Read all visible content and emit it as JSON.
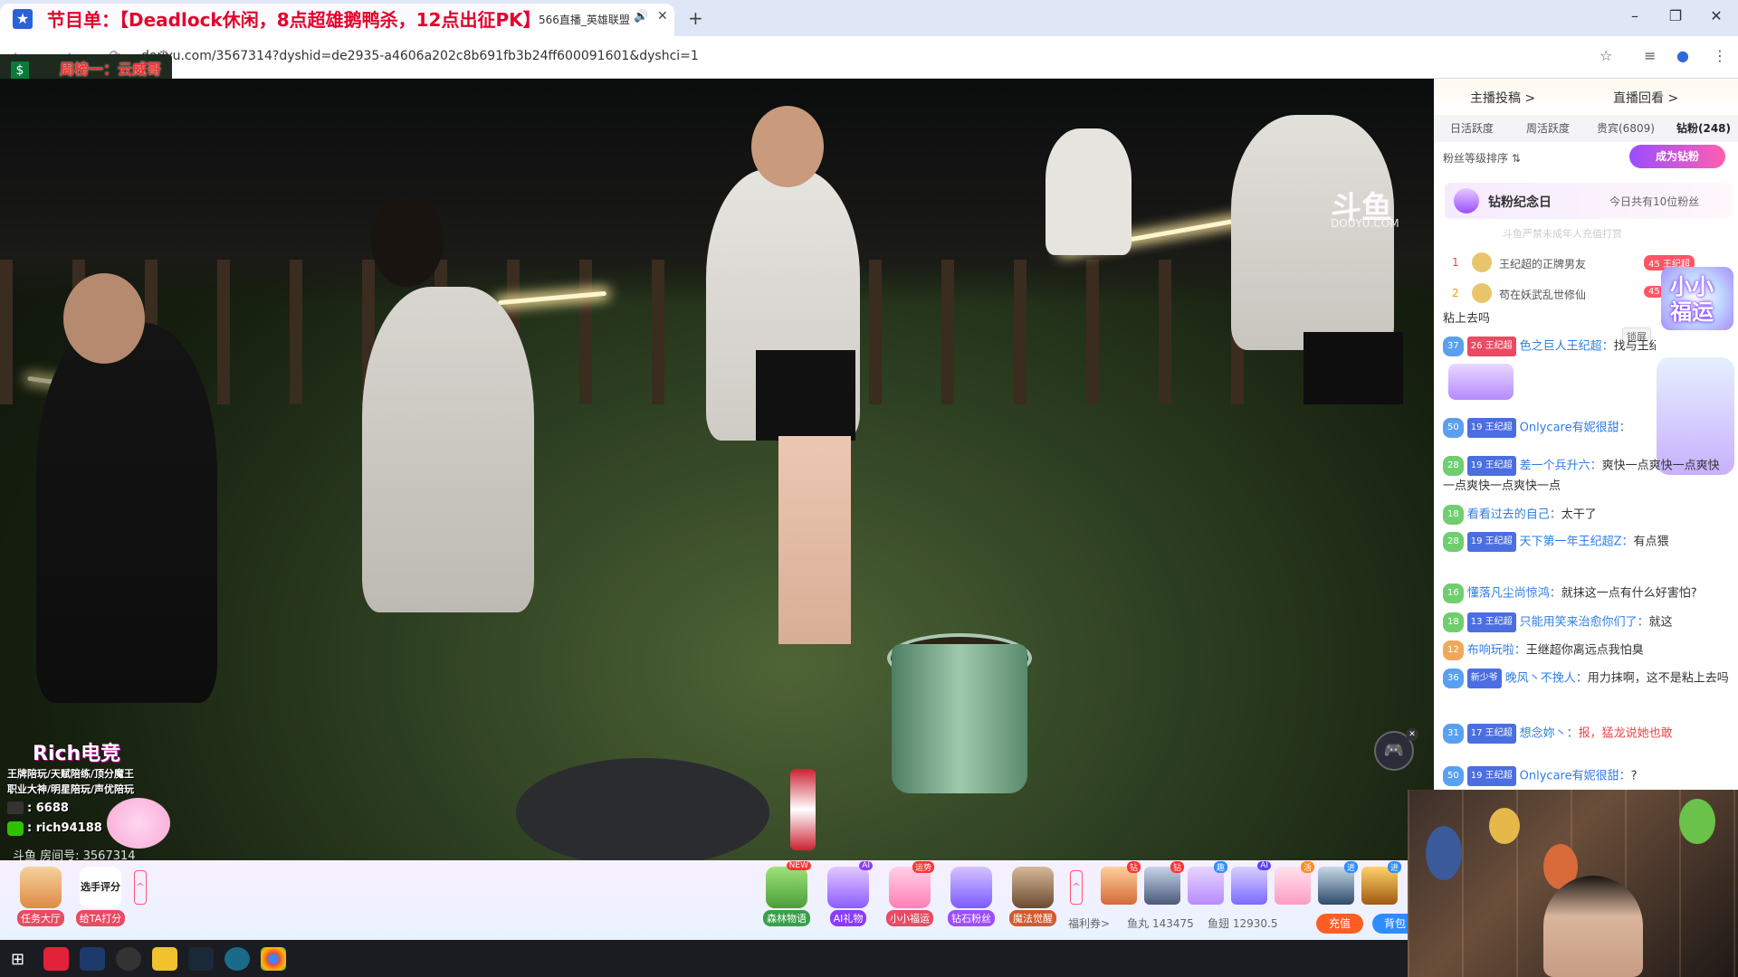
{
  "browser": {
    "tab_title": "566直播_英雄联盟",
    "tab_audio_icon": "speaker-icon",
    "new_tab_symbol": "+",
    "url": "douyu.com/3567314?dyshid=de2935-a4606a202c8b691fb3b24ff600091601&dyshci=1",
    "window": {
      "minimize": "–",
      "restore": "❐",
      "close": "✕"
    },
    "nav_symbols": "← → ⟳ ⚙",
    "toolbar_symbols": {
      "star": "☆",
      "queue": "≡",
      "profile": "●",
      "menu": "⋮"
    }
  },
  "overlay": {
    "banner_text": "节目单：【Deadlock休闲，8点超雄鹅鸭杀，12点出征PK】",
    "sub_text": "周榜一：云威哥",
    "watermark": "斗鱼",
    "watermark_sub": "DOUYU.COM",
    "streamer_title": "Rich电竞",
    "streamer_lines": [
      "王牌陪玩/天赋陪练/顶分魔王",
      "职业大神/明星陪玩/声优陪玩",
      ": 6688",
      ": rich94188"
    ],
    "room_number": "斗鱼 房间号: 3567314"
  },
  "bottom_bar": {
    "left_buttons": [
      {
        "label": "任务大厅"
      },
      {
        "label": "给TA打分",
        "title": "选手评分"
      }
    ],
    "expand_symbol": "^",
    "features": [
      {
        "label": "森林物语",
        "badge": "NEW"
      },
      {
        "label": "AI礼物",
        "badge": "AI"
      },
      {
        "label": "小小福运",
        "badge": "运势"
      },
      {
        "label": "钻石粉丝",
        "badge": ""
      },
      {
        "label": "魔法觉醒",
        "badge": ""
      }
    ],
    "gift_badges": [
      "钻",
      "钻",
      "趣",
      "AI",
      "活",
      "进",
      "进"
    ],
    "welfare": "福利券>",
    "fishball": "鱼丸 143475",
    "fishwing": "鱼翅 12930.5",
    "recharge": "充值",
    "bag": "背包"
  },
  "side_panel": {
    "link_left": "主播投稿 >",
    "link_right": "直播回看 >",
    "tabs": [
      "日活跃度",
      "周活跃度",
      "贵宾(6809)",
      "钻粉(248)"
    ],
    "fan_sort": "粉丝等级排序 ⇅",
    "become_fan": "成为钻粉",
    "fan_day_title": "钻粉纪念日",
    "fan_day_count": "今日共有10位粉丝",
    "fan_day_sub": "斗鱼严禁未成年人充值打赏",
    "ranks": [
      {
        "no": "1",
        "name": "王纪超的正牌男友",
        "level": "45 王纪超"
      },
      {
        "no": "2",
        "name": "苟在妖武乱世修仙",
        "level": "45"
      }
    ],
    "lock_label": "锁屏",
    "lucky_text": "小小福运",
    "chat": [
      {
        "text": "粘上去吗"
      },
      {
        "lv": "37",
        "medal": "26 王纪超",
        "user": "色之巨人王纪超：",
        "msg": "找与王纪超行"
      },
      {
        "lv": "50",
        "medal": "19 王纪超",
        "user": "Onlycare有妮很甜：",
        "msg": ""
      },
      {
        "lv": "28",
        "medal": "19 王纪超",
        "user": "差一个兵升六：",
        "msg": "爽快一点爽快一点爽快一点爽快一点爽快一点"
      },
      {
        "lv": "18",
        "medal": "",
        "user": "看看过去的自己：",
        "msg": "太干了"
      },
      {
        "lv": "28",
        "medal": "19 王纪超",
        "user": "天下第一年王纪超Z：",
        "msg": "有点猥"
      },
      {
        "lv": "16",
        "medal": "",
        "user": "懂落凡尘尚惊鸿：",
        "msg": "就抹这一点有什么好害怕?"
      },
      {
        "lv": "18",
        "medal": "13 王纪超",
        "user": "只能用笑来治愈你们了：",
        "msg": "就这"
      },
      {
        "lv": "12",
        "medal": "",
        "user": "布响玩啦：",
        "msg": "王继超你离远点我怕臭"
      },
      {
        "lv": "36",
        "medal": "新少爷",
        "user": "晚风丶不挽人：",
        "msg": "用力抹啊，这不是粘上去吗"
      },
      {
        "lv": "31",
        "medal": "17 王纪超",
        "user": "想念妳丶：",
        "msg": "报，猛龙说她也敢"
      },
      {
        "lv": "50",
        "medal": "19 王纪超",
        "user": "Onlycare有妮很甜：",
        "msg": "?"
      }
    ]
  },
  "colors": {
    "accent": "#ff5d23",
    "brand_blue": "#2e8cff",
    "banner_red": "#e4002b"
  }
}
